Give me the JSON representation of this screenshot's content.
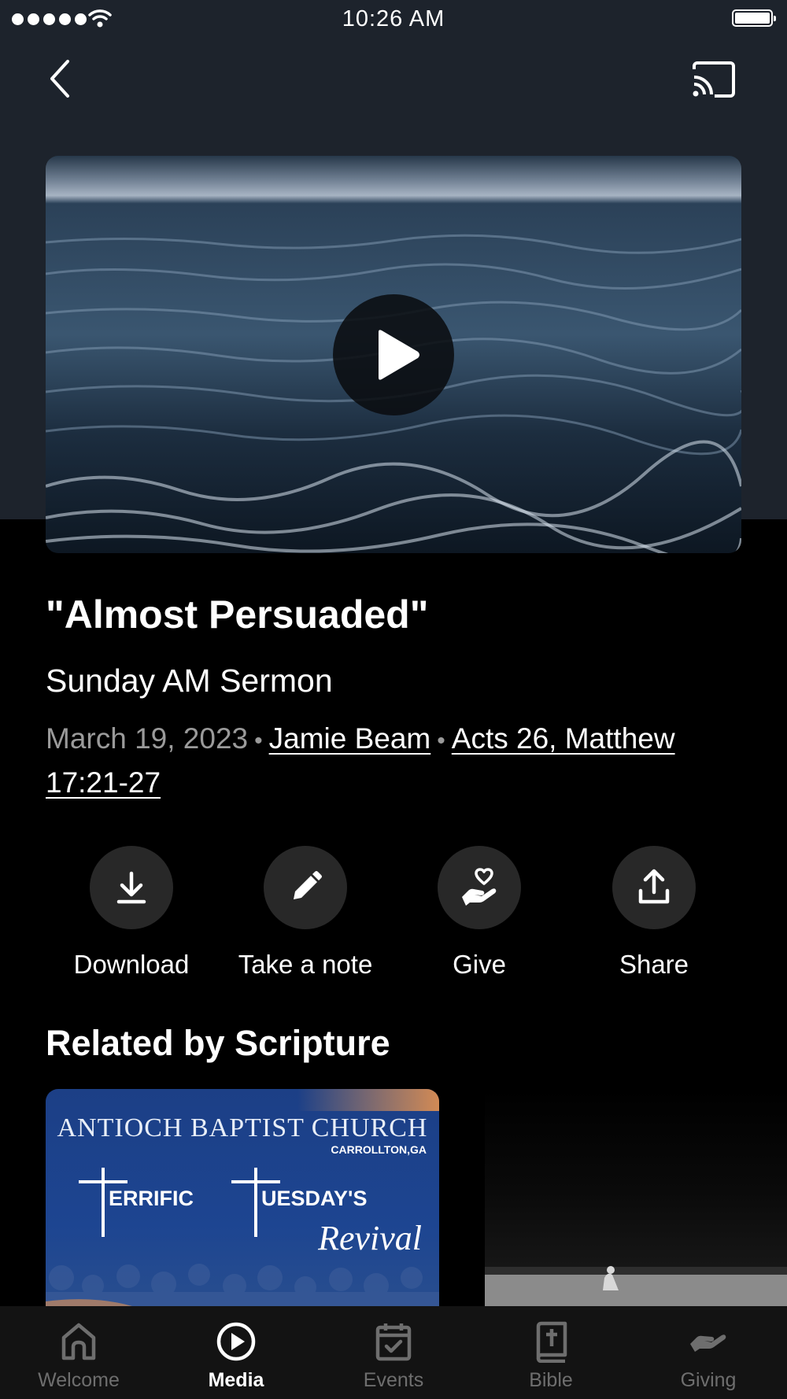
{
  "status_bar": {
    "time": "10:26 AM"
  },
  "media": {
    "title": "\"Almost Persuaded\"",
    "subtitle": "Sunday AM Sermon",
    "date": "March 19, 2023",
    "speaker": "Jamie Beam",
    "scripture": "Acts 26, Matthew 17:21-27"
  },
  "actions": [
    {
      "label": "Download",
      "icon": "download-icon"
    },
    {
      "label": "Take a note",
      "icon": "pencil-icon"
    },
    {
      "label": "Give",
      "icon": "give-heart-hand-icon"
    },
    {
      "label": "Share",
      "icon": "share-icon"
    }
  ],
  "related": {
    "title": "Related by Scripture",
    "card1": {
      "church": "ANTIOCH BAPTIST CHURCH",
      "location": "CARROLLTON,GA",
      "word1": "ERRIFIC",
      "word2": "UESDAY'S",
      "script": "Revival"
    }
  },
  "tabs": [
    {
      "label": "Welcome",
      "icon": "home-icon",
      "active": false
    },
    {
      "label": "Media",
      "icon": "play-circle-icon",
      "active": true
    },
    {
      "label": "Events",
      "icon": "calendar-icon",
      "active": false
    },
    {
      "label": "Bible",
      "icon": "bible-icon",
      "active": false
    },
    {
      "label": "Giving",
      "icon": "giving-hand-icon",
      "active": false
    }
  ],
  "colors": {
    "header_bg": "#1d232c",
    "page_bg": "#000000",
    "tab_bar_bg": "#131313",
    "inactive_tab": "#6e6e6e"
  }
}
